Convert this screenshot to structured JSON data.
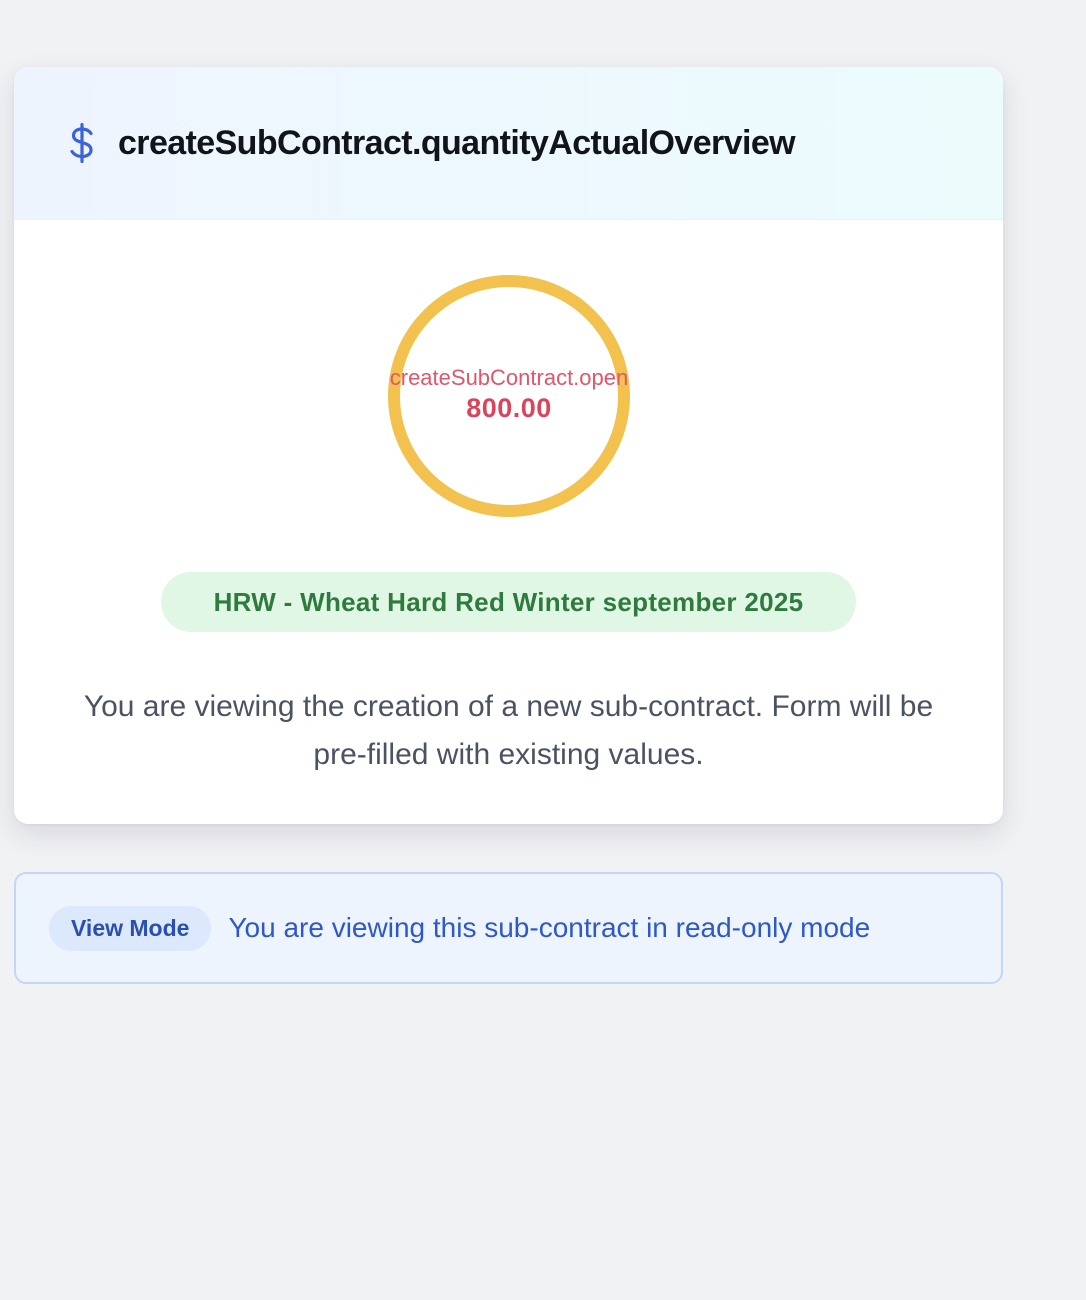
{
  "card": {
    "title": "createSubContract.quantityActualOverview",
    "header_icon": "dollar-icon",
    "ring": {
      "label": "createSubContract.open",
      "value": "800.00",
      "color": "#f2c14e"
    },
    "commodity_pill": "HRW - Wheat Hard Red Winter september 2025",
    "description": "You are viewing the creation of a new sub-contract. Form will be pre-filled with existing values."
  },
  "notice": {
    "badge": "View Mode",
    "message": "You are viewing this sub-contract in read-only mode"
  },
  "colors": {
    "accent_blue": "#3b63d9",
    "ring_gold": "#f2c14e",
    "value_red": "#d9455c",
    "pill_green_text": "#2f7a3d",
    "pill_green_bg": "#e1f7e6"
  }
}
